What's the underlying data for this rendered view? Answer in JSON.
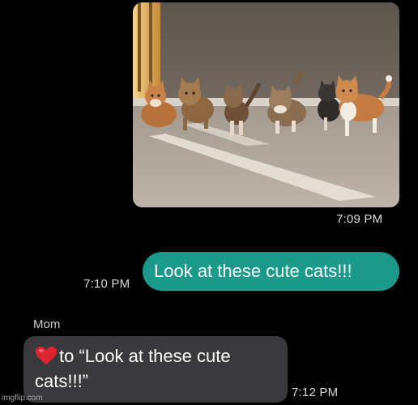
{
  "messages": {
    "image_message": {
      "image_icon": "cats-photo",
      "time": "7:09 PM"
    },
    "sent_message": {
      "text": "Look at these cute cats!!!",
      "time": "7:10 PM",
      "bubble_color": "#1b9a8b"
    },
    "reply": {
      "sender": "Mom",
      "reaction_icon": "red-heart-icon",
      "text_line1": "to “Look at these cute",
      "text_line2": "cats!!!”",
      "time": "7:12 PM",
      "bubble_color": "#3a3a3c"
    }
  },
  "watermark": "imgflip.com"
}
